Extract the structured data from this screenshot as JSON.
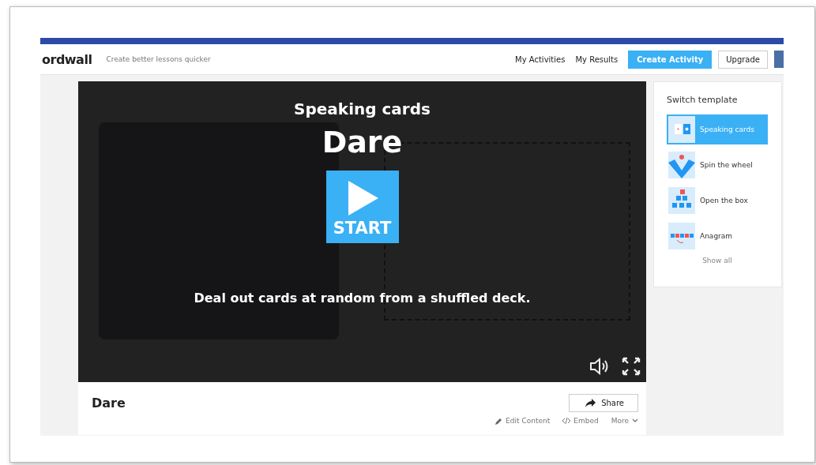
{
  "header": {
    "logo": "ordwall",
    "tagline": "Create better lessons quicker",
    "nav": [
      "My Activities",
      "My Results"
    ],
    "create_button": "Create Activity",
    "upgrade_button": "Upgrade"
  },
  "game": {
    "template": "Speaking cards",
    "title": "Dare",
    "start": "START",
    "description": "Deal out cards at random from a shuffled deck."
  },
  "activity": {
    "title": "Dare",
    "share": "Share",
    "actions": [
      {
        "kind": "edit",
        "label": "Edit Content"
      },
      {
        "kind": "embed",
        "label": "Embed"
      },
      {
        "kind": "more",
        "label": "More"
      }
    ]
  },
  "sidebar": {
    "title": "Switch template",
    "items": [
      {
        "kind": "cards",
        "label": "Speaking cards",
        "selected": true
      },
      {
        "kind": "wheel",
        "label": "Spin the wheel",
        "selected": false
      },
      {
        "kind": "box",
        "label": "Open the box",
        "selected": false
      },
      {
        "kind": "anagram",
        "label": "Anagram",
        "selected": false
      }
    ],
    "show_all": "Show all"
  }
}
